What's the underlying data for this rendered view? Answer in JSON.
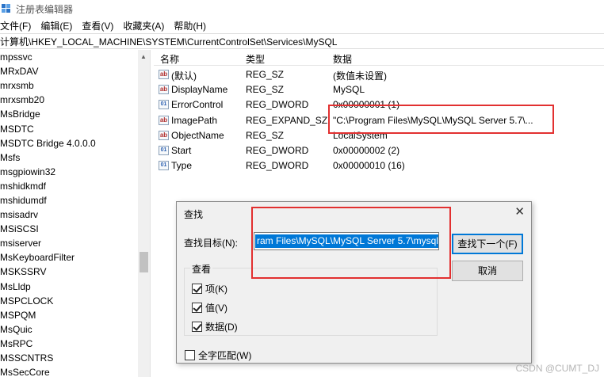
{
  "window": {
    "title": "注册表编辑器"
  },
  "menu": [
    {
      "label": "文件(F)"
    },
    {
      "label": "编辑(E)"
    },
    {
      "label": "查看(V)"
    },
    {
      "label": "收藏夹(A)"
    },
    {
      "label": "帮助(H)"
    }
  ],
  "address": "计算机\\HKEY_LOCAL_MACHINE\\SYSTEM\\CurrentControlSet\\Services\\MySQL",
  "tree": {
    "items": [
      "mpssvc",
      "MRxDAV",
      "mrxsmb",
      "mrxsmb20",
      "MsBridge",
      "MSDTC",
      "MSDTC Bridge 4.0.0.0",
      "Msfs",
      "msgpiowin32",
      "mshidkmdf",
      "mshidumdf",
      "msisadrv",
      "MSiSCSI",
      "msiserver",
      "MsKeyboardFilter",
      "MSKSSRV",
      "MsLldp",
      "MSPCLOCK",
      "MSPQM",
      "MsQuic",
      "MsRPC",
      "MSSCNTRS",
      "MsSecCore"
    ]
  },
  "list": {
    "headers": {
      "name": "名称",
      "type": "类型",
      "data": "数据"
    },
    "rows": [
      {
        "icon": "string-value-icon",
        "name": "(默认)",
        "type": "REG_SZ",
        "data": "(数值未设置)"
      },
      {
        "icon": "string-value-icon",
        "name": "DisplayName",
        "type": "REG_SZ",
        "data": "MySQL"
      },
      {
        "icon": "binary-value-icon",
        "name": "ErrorControl",
        "type": "REG_DWORD",
        "data": "0x00000001 (1)"
      },
      {
        "icon": "string-value-icon",
        "name": "ImagePath",
        "type": "REG_EXPAND_SZ",
        "data": "\"C:\\Program Files\\MySQL\\MySQL Server 5.7\\..."
      },
      {
        "icon": "string-value-icon",
        "name": "ObjectName",
        "type": "REG_SZ",
        "data": "LocalSystem"
      },
      {
        "icon": "binary-value-icon",
        "name": "Start",
        "type": "REG_DWORD",
        "data": "0x00000002 (2)"
      },
      {
        "icon": "binary-value-icon",
        "name": "Type",
        "type": "REG_DWORD",
        "data": "0x00000010 (16)"
      }
    ]
  },
  "find_dialog": {
    "title": "查找",
    "target_label": "查找目标(N):",
    "target_value": "ram Files\\MySQL\\MySQL Server 5.7\\mysqld",
    "find_next": "查找下一个(F)",
    "cancel": "取消",
    "look_at": "查看",
    "keys": "项(K)",
    "values": "值(V)",
    "data": "数据(D)",
    "match_whole": "全字匹配(W)",
    "keys_checked": true,
    "values_checked": true,
    "data_checked": true,
    "match_whole_checked": false
  },
  "watermark": "CSDN @CUMT_DJ",
  "colors": {
    "highlight": "#e23030",
    "selection": "#0078d7",
    "folder": "#e8b84a"
  }
}
